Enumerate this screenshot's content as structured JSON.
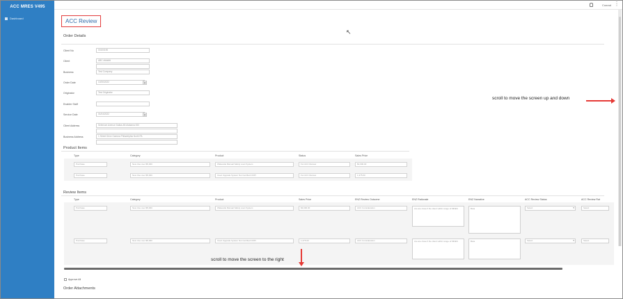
{
  "app": {
    "title": "ACC MRES V495"
  },
  "sidebar": {
    "items": [
      {
        "label": "Dashboard",
        "icon": "dashboard-icon"
      }
    ]
  },
  "topbar": {
    "user": "Conrad",
    "icons": [
      "bell-icon",
      "more-icon"
    ]
  },
  "page": {
    "title": "ACC Review"
  },
  "order_details": {
    "title": "Order Details",
    "fields": [
      {
        "label": "Client No",
        "value": "00100190"
      },
      {
        "label": "Client",
        "value": "ABC ###### "
      },
      {
        "label": "Business",
        "value": "Test Company"
      },
      {
        "label": "Order Date",
        "value": "10/30/2022"
      },
      {
        "label": "Originator",
        "value": "Test Originator"
      },
      {
        "label": "Enabler Staff",
        "value": ""
      },
      {
        "label": "Service Date",
        "value": "01/04/2022"
      },
      {
        "label": "Client Address",
        "value": "Selenium Avenue Dallas AB Alabama 000"
      },
      {
        "label": "Business Address",
        "value": "1 Street Drive Gamma Philadelphia North PA"
      }
    ]
  },
  "product_items": {
    "title": "Product Items",
    "columns": [
      "Type",
      "Category",
      "Product",
      "Status",
      "Sales Price"
    ],
    "rows": [
      {
        "type": "Purchase",
        "category": "New Use over $5,000",
        "product": "Wakeside Manual Safety Loan System",
        "status": "For ACC Review",
        "price": "$3,000.00"
      },
      {
        "type": "Purchase",
        "category": "New Use over $5,000",
        "product": "Used Upgrade System Not Certified CDPI",
        "status": "For ACC Review",
        "price": "1,375.00"
      }
    ]
  },
  "review_items": {
    "title": "Review Items",
    "columns": [
      "Type",
      "Category",
      "Product",
      "Sales Price",
      "ENZ Review Outcome",
      "ENZ Rationale",
      "ENZ Narrative",
      "ACC Review Status",
      "ACC Review Rat"
    ],
    "rows": [
      {
        "type": "Purchase",
        "category": "New Use over $5,000",
        "product": "Wakeside Manual Safety Loan System",
        "price": "$3,000.00",
        "outcome": "ACC Consideration",
        "rationale": "Are are close if the client within range of MRES",
        "narrative": "Beta",
        "status": "Select",
        "rat": "Select"
      },
      {
        "type": "Purchase",
        "category": "New Use over $5,000",
        "product": "Used Upgrade System Not Certified CDPI",
        "price": "1,375.00",
        "outcome": "ACC Consideration",
        "rationale": "Are are close if the client within range of MRES",
        "narrative": "Beta",
        "status": "Select",
        "rat": "Select"
      }
    ]
  },
  "approve_all": {
    "label": "Approve All"
  },
  "order_attachments": {
    "title": "Order Attachments"
  },
  "annotations": {
    "vertical": "scroll to move the screen up and down",
    "horizontal": "scroll to move the screen to the right"
  },
  "colors": {
    "sidebar": "#2f7fc4",
    "highlight": "#e23b3b",
    "arrow": "#e53935"
  }
}
